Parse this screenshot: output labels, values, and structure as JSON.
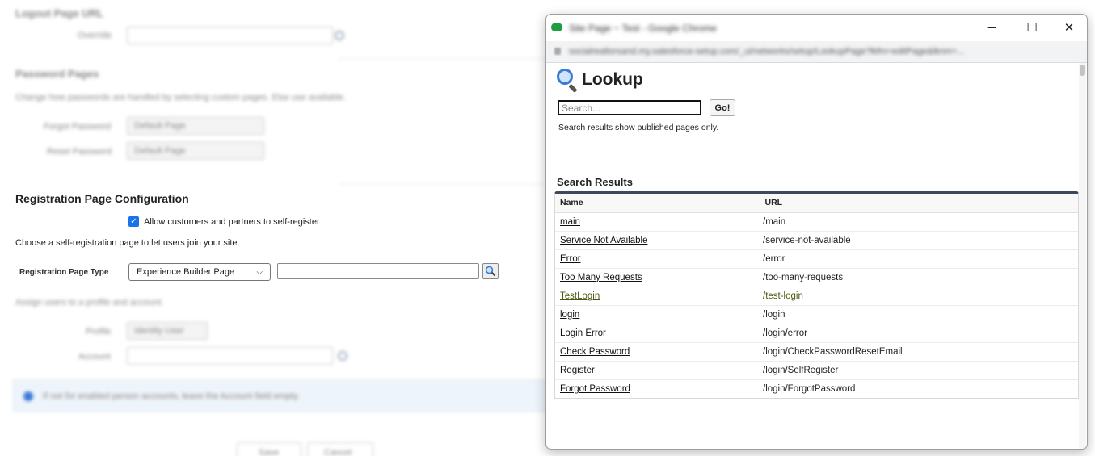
{
  "background": {
    "sections": {
      "logout_heading": "Logout Page URL",
      "logout_label": "Override",
      "password_heading": "Password Pages",
      "password_desc": "Change how passwords are handled by selecting custom pages. Else use available.",
      "forgot_label": "Forgot Password",
      "forgot_value": "Default Page",
      "reset_label": "Reset Password",
      "reset_value": "Default Page",
      "assign_desc": "Assign users to a profile and account.",
      "profile_label": "Profile",
      "profile_value": "Identity User",
      "account_label": "Account",
      "info_text": "If not for enabled person accounts, leave the Account field empty."
    },
    "registration": {
      "heading": "Registration Page Configuration",
      "allow_label": "Allow customers and partners to self-register",
      "allow_checked": true,
      "choose_text": "Choose a self-registration page to let users join your site.",
      "type_label": "Registration Page Type",
      "type_value": "Experience Builder Page",
      "page_value": ""
    },
    "footer_buttons": [
      "Save",
      "Cancel"
    ]
  },
  "popup": {
    "window_title": "Site Page ~ Test - Google Chrome",
    "address": "socialrealtorsand.my.salesforce-setup.com/_ui/networks/setup/LookupPage?lkfm=editPage&lknm=...",
    "window_controls": {
      "minimize": "─",
      "maximize": "☐",
      "close": "✕"
    },
    "lookup_title": "Lookup",
    "search": {
      "placeholder": "Search...",
      "value": "",
      "go_label": "Go!",
      "hint": "Search results show published pages only."
    },
    "results_title": "Search Results",
    "columns": {
      "name": "Name",
      "url": "URL"
    },
    "rows": [
      {
        "name": "main",
        "url": "/main"
      },
      {
        "name": "Service Not Available",
        "url": "/service-not-available"
      },
      {
        "name": "Error",
        "url": "/error"
      },
      {
        "name": "Too Many Requests",
        "url": "/too-many-requests"
      },
      {
        "name": "TestLogin",
        "url": "/test-login"
      },
      {
        "name": "login",
        "url": "/login"
      },
      {
        "name": "Login Error",
        "url": "/login/error"
      },
      {
        "name": "Check Password",
        "url": "/login/CheckPasswordResetEmail"
      },
      {
        "name": "Register",
        "url": "/login/SelfRegister"
      },
      {
        "name": "Forgot Password",
        "url": "/login/ForgotPassword"
      }
    ],
    "highlighted_row": "TestLogin",
    "colors": {
      "highlight": "#dff578",
      "table_header_bar": "#3b4a5a",
      "app_icon": "#1e9e3e"
    }
  }
}
